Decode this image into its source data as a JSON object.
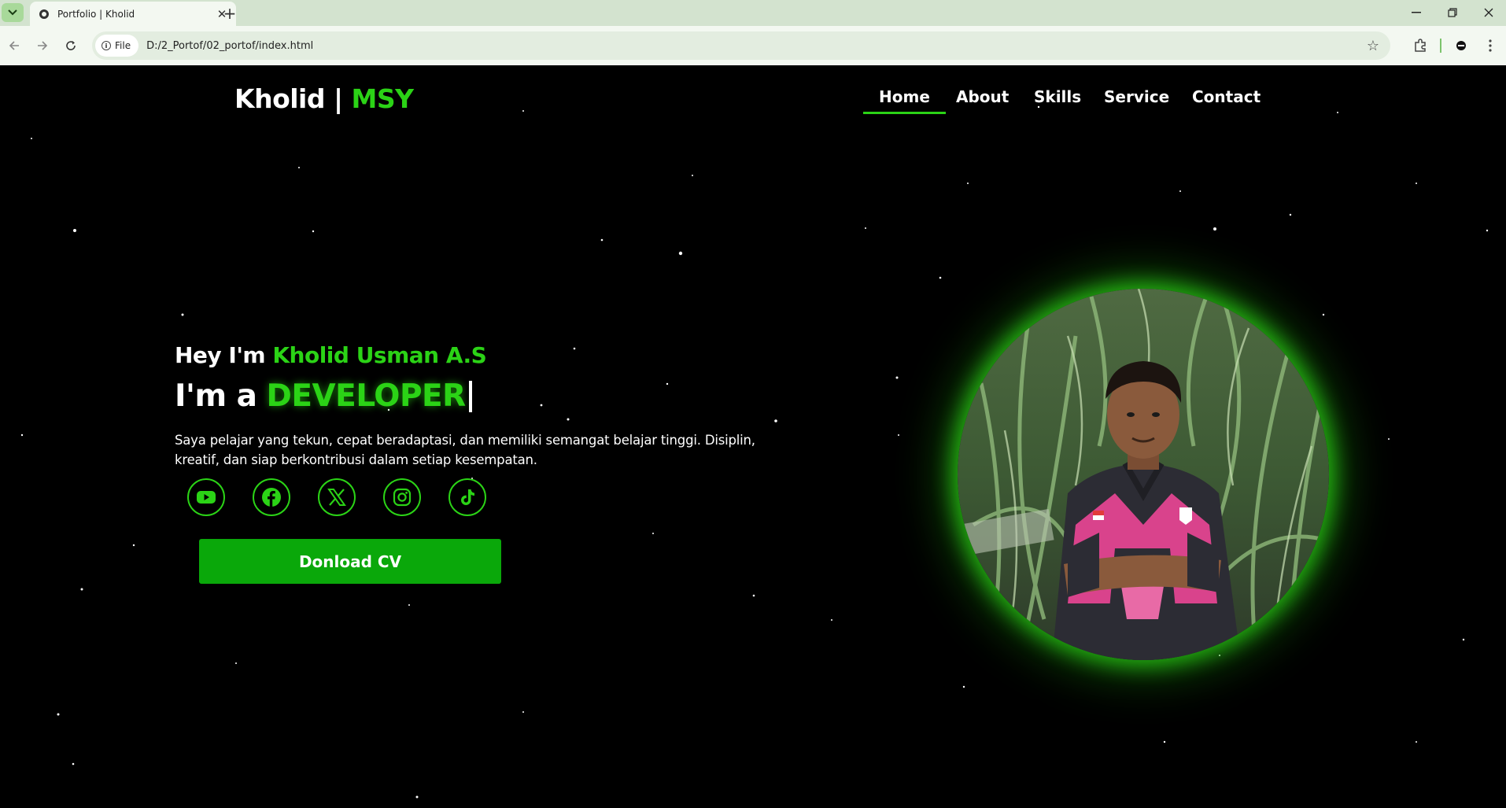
{
  "browser": {
    "tab_title": "Portfolio | Kholid",
    "site_chip_label": "File",
    "url": "D:/2_Portof/02_portof/index.html"
  },
  "header": {
    "logo_main": "Kholid | ",
    "logo_accent": "MSY",
    "nav": [
      {
        "label": "Home",
        "active": true
      },
      {
        "label": "About",
        "active": false
      },
      {
        "label": "Skills",
        "active": false
      },
      {
        "label": "Service",
        "active": false
      },
      {
        "label": "Contact",
        "active": false
      }
    ]
  },
  "hero": {
    "greeting": "Hey I'm ",
    "name": "Kholid Usman A.S",
    "role_prefix": "I'm a",
    "role": "DEVELOPER",
    "description": "Saya pelajar yang tekun, cepat beradaptasi, dan memiliki semangat belajar tinggi. Disiplin, kreatif, dan siap berkontribusi dalam setiap kesempatan.",
    "socials": [
      {
        "icon": "youtube-icon"
      },
      {
        "icon": "facebook-icon"
      },
      {
        "icon": "x-twitter-icon"
      },
      {
        "icon": "instagram-icon"
      },
      {
        "icon": "tiktok-icon"
      }
    ],
    "cv_button": "Donload CV"
  },
  "colors": {
    "accent": "#2bd316",
    "button": "#0aa80a",
    "background": "#000000"
  }
}
